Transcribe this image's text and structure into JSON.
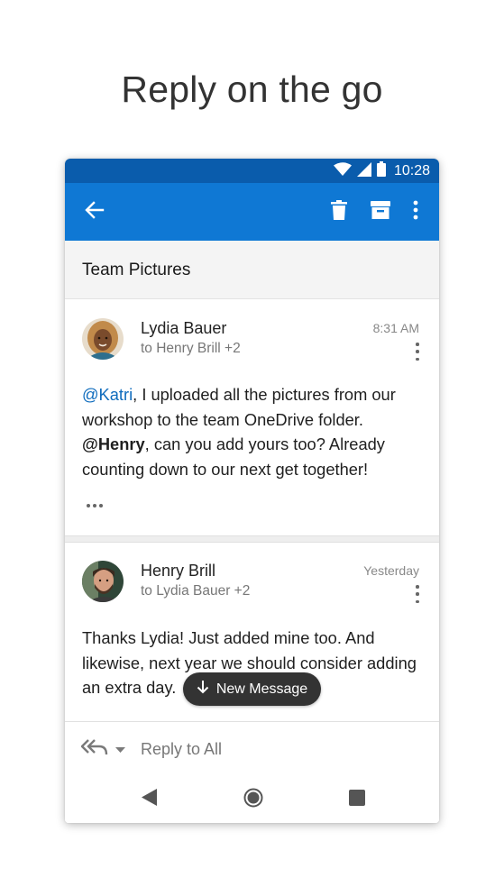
{
  "headline": "Reply on the go",
  "status_bar": {
    "time": "10:28",
    "icons": [
      "wifi-icon",
      "cellular-signal-icon",
      "battery-icon"
    ]
  },
  "app_bar": {
    "actions": [
      "back-arrow-icon",
      "delete-icon",
      "archive-icon",
      "more-options-icon"
    ],
    "color": "#0f78d4",
    "status_color": "#0a5cac"
  },
  "thread": {
    "subject": "Team Pictures",
    "messages": [
      {
        "sender": "Lydia Bauer",
        "recipients": "to Henry Brill +2",
        "time": "8:31 AM",
        "body": {
          "mention1": "@Katri",
          "text1": ", I uploaded all the pictures from our workshop to the team OneDrive folder. ",
          "mention2": "@Henry",
          "text2": ", can you add yours too? Already counting down to our next get together!"
        },
        "has_more": true
      },
      {
        "sender": "Henry Brill",
        "recipients": "to Lydia Bauer +2",
        "time": "Yesterday",
        "body": {
          "text1": "Thanks Lydia! Just added mine too. And likewise, next year we should consider adding an extra day."
        }
      }
    ]
  },
  "new_message_pill": {
    "label": "New Message",
    "icon": "arrow-down-icon"
  },
  "reply_bar": {
    "label": "Reply to All",
    "icons": [
      "reply-all-icon",
      "dropdown-caret-icon"
    ]
  },
  "nav_bar": {
    "buttons": [
      "back-triangle-icon",
      "home-circle-icon",
      "recents-square-icon"
    ]
  },
  "colors": {
    "accent": "#0f78d4",
    "mention_link": "#0f6cbd",
    "pill_background": "#333333"
  }
}
